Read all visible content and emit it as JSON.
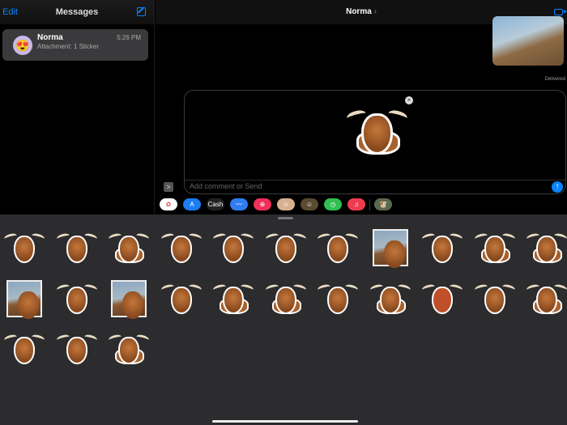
{
  "sidebar": {
    "edit": "Edit",
    "title": "Messages",
    "conversation": {
      "name": "Norma",
      "time": "5:26 PM",
      "preview": "Attachment: 1 Sticker",
      "avatar": "😍"
    }
  },
  "chat": {
    "title": "Norma",
    "chevron": "›",
    "status": "Delivered",
    "input_placeholder": "Add comment or Send",
    "remove": "×",
    "send": "↑",
    "expand": ">"
  },
  "apps": [
    {
      "name": "photos",
      "color": "#ffffff",
      "label": "✿"
    },
    {
      "name": "app-store",
      "color": "#1c7cf0",
      "label": "A"
    },
    {
      "name": "apple-cash",
      "color": "#222222",
      "label": "Cash"
    },
    {
      "name": "audio",
      "color": "#2f7df0",
      "label": "〰"
    },
    {
      "name": "search-images",
      "color": "#f0305a",
      "label": "⊕"
    },
    {
      "name": "memoji-1",
      "color": "#d8b090",
      "label": "☺"
    },
    {
      "name": "memoji-2",
      "color": "#5a4a30",
      "label": "☺"
    },
    {
      "name": "find-my",
      "color": "#30c050",
      "label": "◷"
    },
    {
      "name": "music",
      "color": "#f03c50",
      "label": "♫"
    },
    {
      "name": "sticker-app",
      "color": "#5a6a50",
      "label": "🐮"
    }
  ],
  "stickers": [
    "head",
    "head-hat",
    "pair",
    "head-glasses",
    "splash",
    "hearts",
    "reading",
    "photo",
    "glasses",
    "herd",
    "standing",
    "photo",
    "head-hair",
    "photo",
    "head-hat",
    "standing",
    "round",
    "head-glasses",
    "standing",
    "head-red",
    "head",
    "standing",
    "head-glasses",
    "head-hat",
    "round"
  ]
}
